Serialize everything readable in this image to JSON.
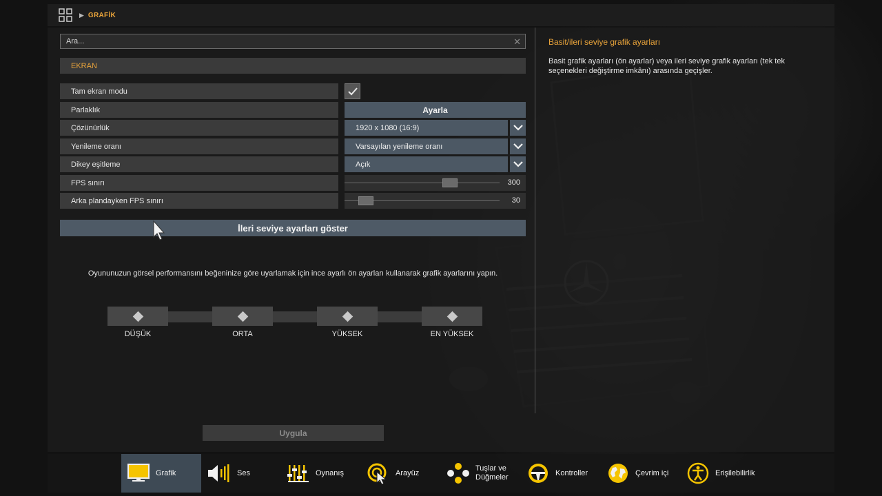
{
  "breadcrumb": {
    "current": "GRAFİK"
  },
  "search": {
    "placeholder": "Ara..."
  },
  "section": {
    "title": "EKRAN"
  },
  "settings": [
    {
      "label": "Tam ekran modu",
      "type": "checkbox",
      "checked": true
    },
    {
      "label": "Parlaklık",
      "type": "button",
      "value": "Ayarla"
    },
    {
      "label": "Çözünürlük",
      "type": "dropdown",
      "value": "1920 x 1080 (16:9)"
    },
    {
      "label": "Yenileme oranı",
      "type": "dropdown",
      "value": "Varsayılan yenileme oranı"
    },
    {
      "label": "Dikey eşitleme",
      "type": "dropdown",
      "value": "Açık"
    },
    {
      "label": "FPS sınırı",
      "type": "slider",
      "value": "300",
      "fraction": 0.7
    },
    {
      "label": "Arka plandayken FPS sınırı",
      "type": "slider",
      "value": "30",
      "fraction": 0.1
    }
  ],
  "advanced_button": "İleri seviye ayarları göster",
  "preset_description": "Oyununuzun görsel performansını beğeninize göre uyarlamak için ince ayarlı ön ayarları kullanarak grafik ayarlarını yapın.",
  "presets": [
    "DÜŞÜK",
    "ORTA",
    "YÜKSEK",
    "EN YÜKSEK"
  ],
  "help": {
    "title": "Basit/ileri seviye grafik ayarları",
    "text": "Basit grafik ayarları (ön ayarlar) veya ileri seviye grafik ayarları (tek tek seçenekleri değiştirme imkânı) arasında geçişler."
  },
  "apply_button": "Uygula",
  "nav": [
    {
      "label": "Grafik",
      "icon": "monitor-icon",
      "active": true
    },
    {
      "label": "Ses",
      "icon": "speaker-icon",
      "active": false
    },
    {
      "label": "Oynanış",
      "icon": "sliders-icon",
      "active": false
    },
    {
      "label": "Arayüz",
      "icon": "cursor-target-icon",
      "active": false
    },
    {
      "label": "Tuşlar ve Düğmeler",
      "icon": "gamepad-buttons-icon",
      "active": false
    },
    {
      "label": "Kontroller",
      "icon": "steering-wheel-icon",
      "active": false
    },
    {
      "label": "Çevrim içi",
      "icon": "globe-icon",
      "active": false
    },
    {
      "label": "Erişilebilirlik",
      "icon": "accessibility-icon",
      "active": false
    }
  ],
  "colors": {
    "accent": "#e8a33a",
    "control": "#4c5864",
    "nav_icon": "#f5c400"
  }
}
